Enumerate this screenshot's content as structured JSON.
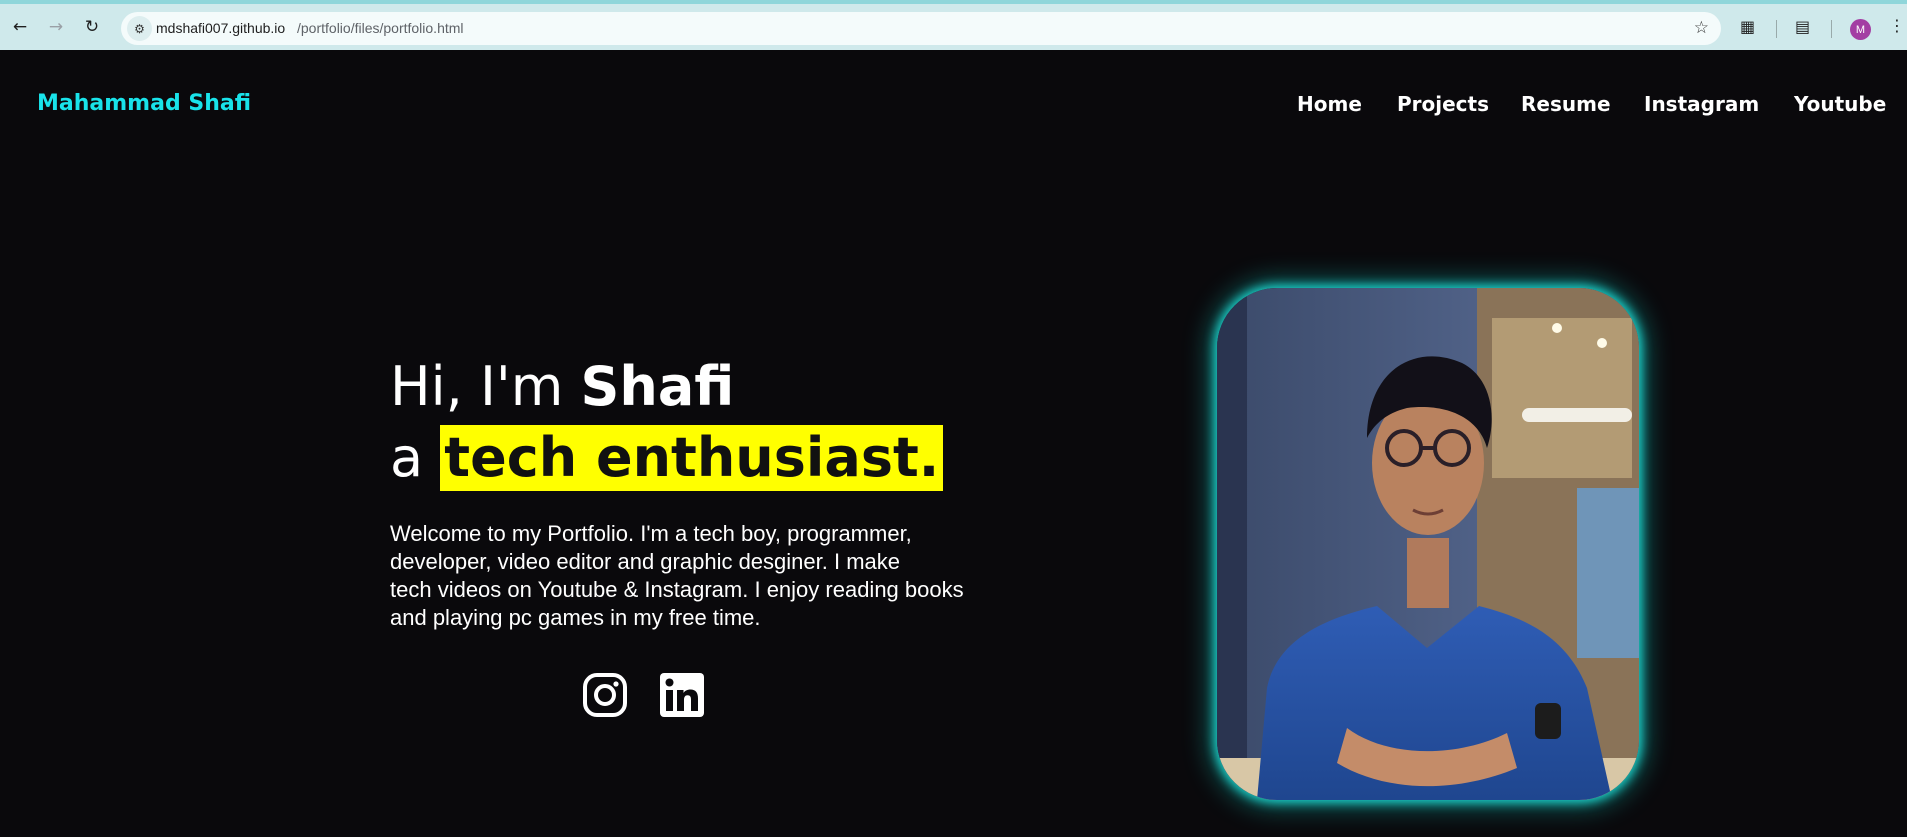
{
  "browser": {
    "url_host": "mdshafi007.github.io",
    "url_path": "/portfolio/files/portfolio.html",
    "profile_initial": "M"
  },
  "site": {
    "brand": "Mahammad Shafi",
    "nav": [
      "Home",
      "Projects",
      "Resume",
      "Instagram",
      "Youtube"
    ]
  },
  "hero": {
    "greeting": "Hi, I'm ",
    "name": "Shafi",
    "line2_prefix": "a ",
    "highlight": "tech enthusiast.",
    "intro_lines": [
      "Welcome to my Portfolio. I'm a tech boy, programmer,",
      "developer, video editor and graphic desginer. I make",
      "tech videos on Youtube & Instagram. I enjoy reading books",
      "and playing pc games in my free time."
    ]
  },
  "social": [
    "instagram-icon",
    "linkedin-icon"
  ],
  "colors": {
    "brand": "#19e3ea",
    "highlight": "#ffff00",
    "background": "#0a090c",
    "glow": "#1ccfc8"
  }
}
